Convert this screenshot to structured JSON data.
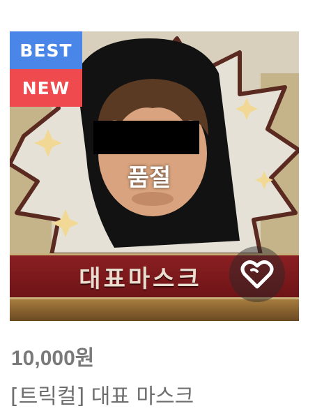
{
  "product": {
    "badges": {
      "best": "BEST",
      "new": "NEW"
    },
    "overlay_status": "품절",
    "banner_text": "대표마스크",
    "price": "10,000원",
    "name": "[트릭컬] 대표 마스크",
    "wishlist_icon": "heart-outline-icon"
  },
  "colors": {
    "best_badge": "#4a86e8",
    "new_badge": "#ef4b4f",
    "banner": "#7a1a1d",
    "price_text": "#7a7a7a",
    "name_text": "#6e6e6e"
  }
}
